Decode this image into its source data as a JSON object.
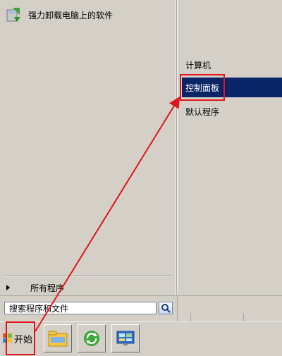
{
  "program_list": {
    "items": [
      {
        "label": "强力卸载电脑上的软件",
        "icon": "uninstall-program-icon"
      }
    ],
    "all_programs_label": "所有程序"
  },
  "right_links": {
    "items": [
      {
        "label": "计算机",
        "highlighted": false
      },
      {
        "label": "控制面板",
        "highlighted": true
      },
      {
        "label": "默认程序",
        "highlighted": false
      }
    ]
  },
  "search": {
    "placeholder": "搜索程序和文件",
    "button_icon": "search-icon"
  },
  "taskbar": {
    "start_label": "开始",
    "start_icon": "windows-flag-icon",
    "pinned": [
      {
        "name": "explorer-icon"
      },
      {
        "name": "refresh-sync-icon"
      },
      {
        "name": "control-panel-icon"
      }
    ]
  },
  "colors": {
    "highlight": "#0a2468",
    "annotation_red": "#e0141c",
    "background": "#d4d0c8"
  }
}
